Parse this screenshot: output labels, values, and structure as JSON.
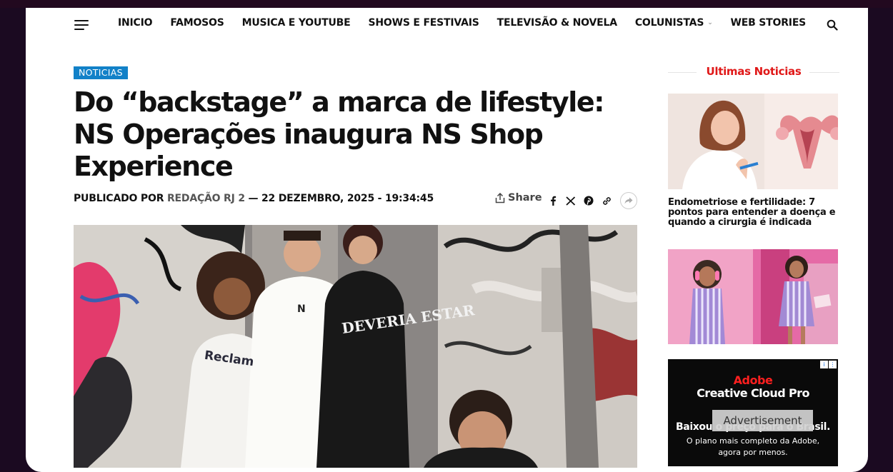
{
  "nav": {
    "items": [
      {
        "label": "INICIO"
      },
      {
        "label": "FAMOSOS"
      },
      {
        "label": "MUSICA E YOUTUBE"
      },
      {
        "label": "SHOWS E FESTIVAIS"
      },
      {
        "label": "TELEVISÃO & NOVELA"
      },
      {
        "label": "COLUNISTAS"
      },
      {
        "label": "WEB STORIES"
      }
    ]
  },
  "article": {
    "category": "NOTICIAS",
    "title": "Do “backstage” a marca de lifestyle: NS Operações inaugura NS Shop Experience",
    "byline_prefix": "PUBLICADO POR",
    "author": "REDAÇÃO RJ 2",
    "date": " — 22 DEZEMBRO, 2025 - 19:34:45",
    "share_label": "Share",
    "hero_shirt_text_1": "Reclam",
    "hero_shirt_text_2": "DEVERIA ESTAR"
  },
  "sidebar": {
    "heading": "Ultimas Noticias",
    "posts": [
      {
        "title": "Endometriose e fertilidade: 7 pontos para entender a doença e quando a cirurgia é indicada"
      }
    ]
  },
  "ad": {
    "brand": "Adobe",
    "product": "Creative Cloud Pro",
    "headline": "Baixou o preço para o Brasil.",
    "line2": "O plano mais completo da Adobe,",
    "line3": "agora por menos.",
    "overlay_label": "Advertisement"
  },
  "colors": {
    "background": "#1b0a21",
    "badge": "#1281c8",
    "sidebar_heading": "#e01818"
  }
}
